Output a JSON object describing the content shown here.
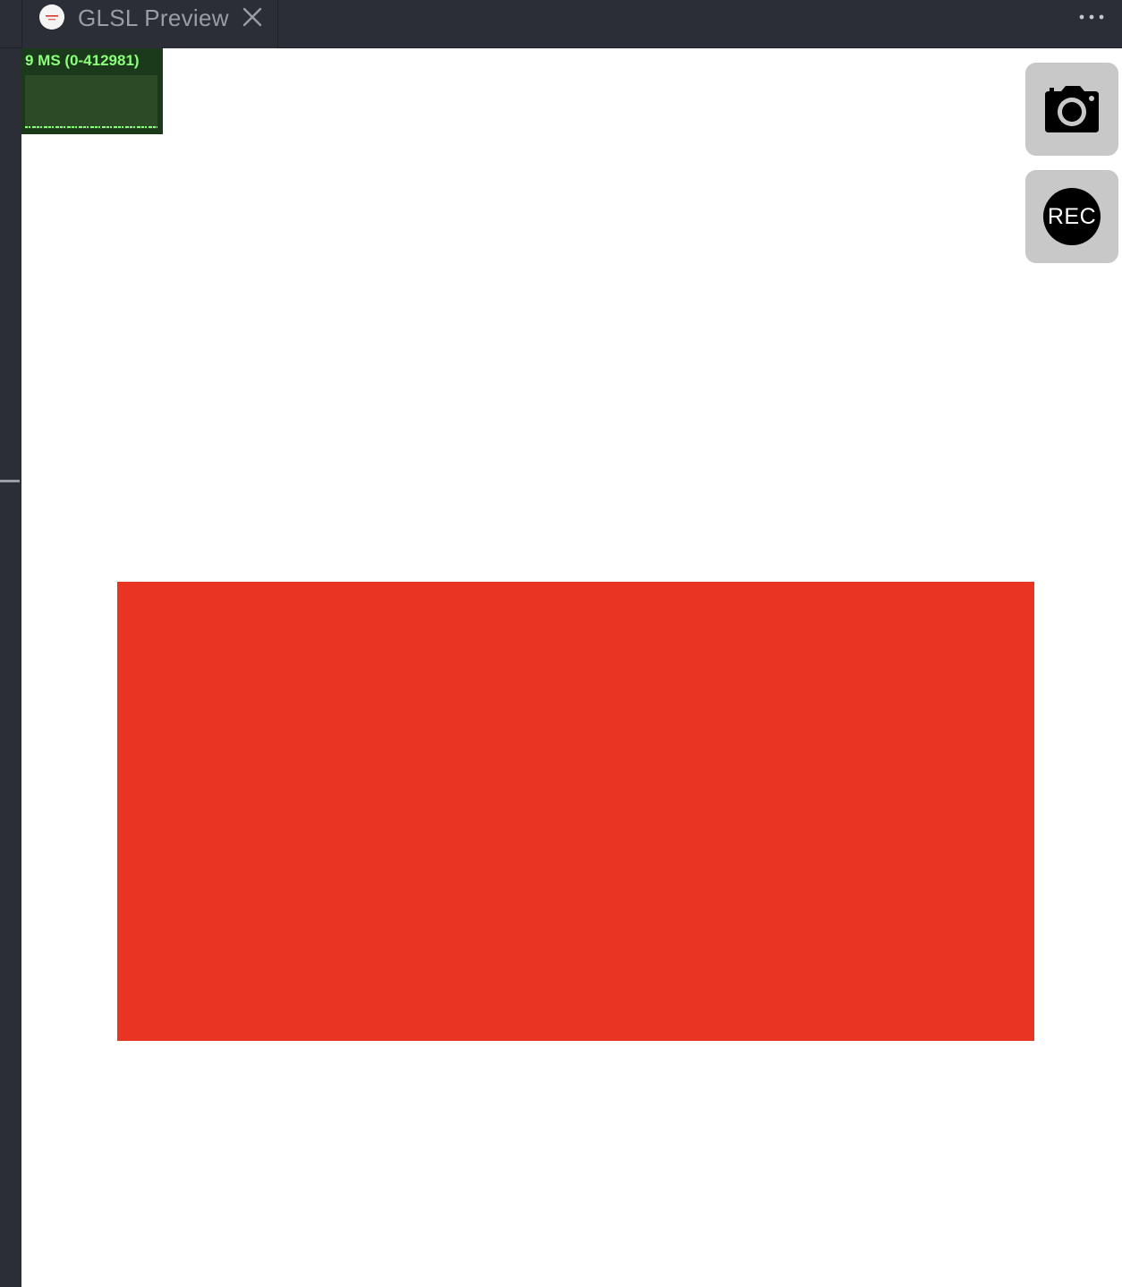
{
  "tab": {
    "title": "GLSL Preview",
    "icon": "shader-toy-logo-icon",
    "close_icon": "close-icon"
  },
  "toolbar": {
    "more_icon": "more-actions-icon"
  },
  "stats": {
    "label": "9 MS (0-412981)"
  },
  "controls": {
    "capture_icon": "camera-icon",
    "record_label": "REC"
  },
  "colors": {
    "render_fill": "#e93323",
    "canvas_background": "#ffffff",
    "stats_text": "#8cff7a",
    "stats_background": "#1b3a1b",
    "chrome_background": "#2b2e36"
  }
}
